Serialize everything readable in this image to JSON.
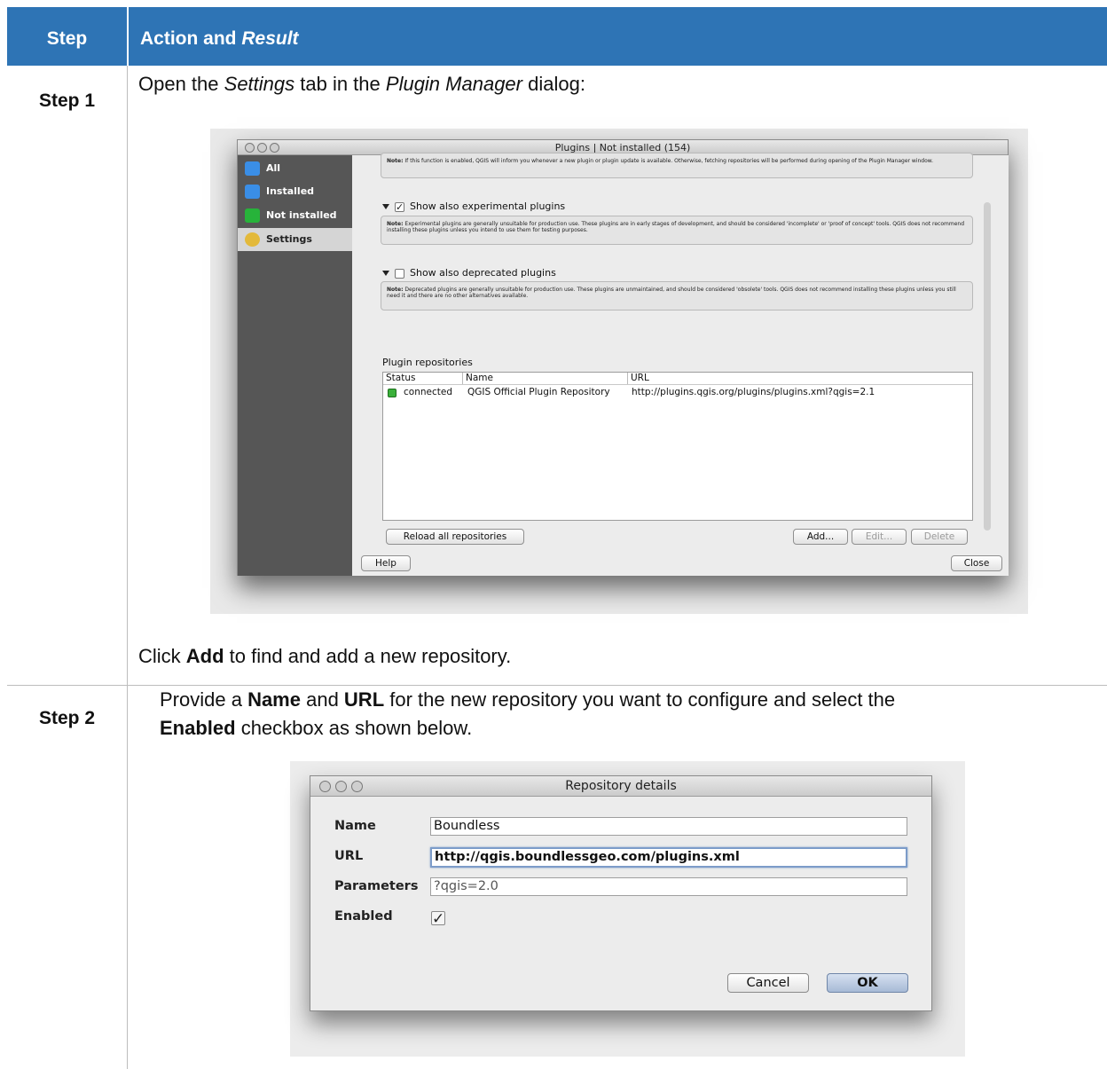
{
  "table": {
    "header_step": "Step",
    "header_action": "Action and",
    "header_result": "Result"
  },
  "step1": {
    "label": "Step 1",
    "intro_a": "Open the ",
    "intro_settings": "Settings",
    "intro_b": " tab in the ",
    "intro_pm": "Plugin Manager",
    "intro_c": " dialog:",
    "outro_a": "Click ",
    "outro_add": "Add",
    "outro_b": " to find and add a new repository."
  },
  "step2": {
    "label": "Step 2",
    "line1_a": "Provide a ",
    "line1_name": "Name",
    "line1_b": " and ",
    "line1_url": "URL",
    "line1_c": " for the new repository you want to configure and select the",
    "line2_enabled": "Enabled",
    "line2_b": " checkbox as shown below."
  },
  "plugins_window": {
    "title": "Plugins | Not installed (154)",
    "sidebar": [
      {
        "label": "All",
        "icon": "puzzle-icon",
        "color": "#3a8ee6"
      },
      {
        "label": "Installed",
        "icon": "puzzle-icon",
        "color": "#3a8ee6"
      },
      {
        "label": "Not installed",
        "icon": "puzzle-icon",
        "color": "#27b33a"
      },
      {
        "label": "Settings",
        "icon": "gear-icon",
        "color": "#e3b93a"
      }
    ],
    "note_top": "If this function is enabled, QGIS will inform you whenever a new plugin or plugin update is available. Otherwise, fetching repositories will be performed during opening of the Plugin Manager window.",
    "note_label": "Note:",
    "experimental_label": "Show also experimental plugins",
    "experimental_checked": true,
    "experimental_note": "Experimental plugins are generally unsuitable for production use. These plugins are in early stages of development, and should be considered 'incomplete' or 'proof of concept' tools. QGIS does not recommend installing these plugins unless you intend to use them for testing purposes.",
    "deprecated_label": "Show also deprecated plugins",
    "deprecated_checked": false,
    "deprecated_note": "Deprecated plugins are generally unsuitable for production use. These plugins are unmaintained, and should be considered 'obsolete' tools. QGIS does not recommend installing these plugins unless you still need it and there are no other alternatives available.",
    "repositories_title": "Plugin repositories",
    "columns": [
      "Status",
      "Name",
      "URL"
    ],
    "rows": [
      {
        "status": "connected",
        "name": "QGIS Official Plugin Repository",
        "url": "http://plugins.qgis.org/plugins/plugins.xml?qgis=2.1"
      }
    ],
    "reload_button": "Reload all repositories",
    "add_button": "Add...",
    "edit_button": "Edit...",
    "delete_button": "Delete",
    "help_button": "Help",
    "close_button": "Close"
  },
  "repo_window": {
    "title": "Repository details",
    "name_label": "Name",
    "name_value": "Boundless",
    "url_label": "URL",
    "url_value": "http://qgis.boundlessgeo.com/plugins.xml",
    "params_label": "Parameters",
    "params_value": "?qgis=2.0",
    "enabled_label": "Enabled",
    "enabled_checked": true,
    "cancel_button": "Cancel",
    "ok_button": "OK"
  }
}
